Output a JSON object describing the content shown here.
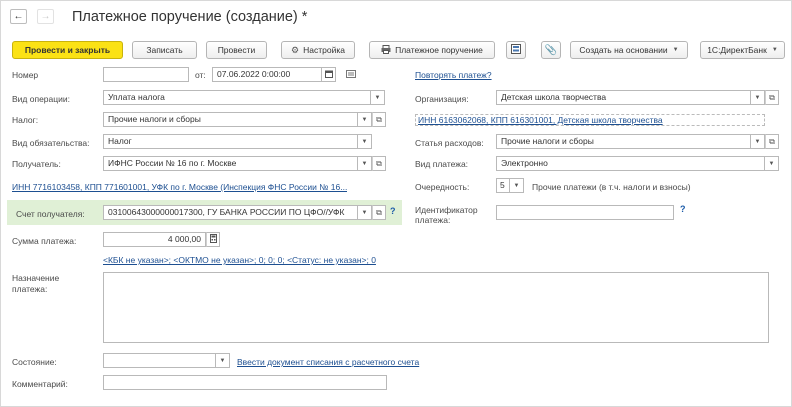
{
  "window": {
    "title": "Платежное поручение (создание) *"
  },
  "nav": {
    "back_glyph": "←",
    "forward_glyph": "→"
  },
  "toolbar": {
    "post_close": "Провести и закрыть",
    "save": "Записать",
    "post": "Провести",
    "settings": "Настройка",
    "payment_order": "Платежное поручение",
    "create_based_on": "Создать на основании",
    "direct_bank": "1С:ДиректБанк"
  },
  "form": {
    "number": {
      "label": "Номер",
      "value": ""
    },
    "date": {
      "label": "от:",
      "value": "07.06.2022  0:00:00"
    },
    "repeat_link": "Повторять платеж?",
    "operation": {
      "label": "Вид операции:",
      "value": "Уплата налога"
    },
    "organization": {
      "label": "Организация:",
      "value": "Детская школа творчества"
    },
    "tax": {
      "label": "Налог:",
      "value": "Прочие налоги и сборы"
    },
    "org_details_link": "ИНН 6163062068, КПП 616301001, Детская школа творчества",
    "obligation": {
      "label": "Вид обязательства:",
      "value": "Налог"
    },
    "expense_item": {
      "label": "Статья расходов:",
      "value": "Прочие налоги и сборы"
    },
    "recipient": {
      "label": "Получатель:",
      "value": "ИФНС России № 16 по г. Москве"
    },
    "payment_type": {
      "label": "Вид платежа:",
      "value": "Электронно"
    },
    "recipient_link": "ИНН 7716103458, КПП 771601001, УФК по г. Москве (Инспекция ФНС России № 16...",
    "priority": {
      "label": "Очередность:",
      "value": "5",
      "note": "Прочие платежи (в т.ч. налоги и взносы)"
    },
    "recipient_account": {
      "label": "Счет получателя:",
      "value": "03100643000000017300, ГУ БАНКА РОССИИ ПО ЦФО//УФК"
    },
    "payment_id": {
      "label_line1": "Идентификатор",
      "label_line2": "платежа:",
      "value": ""
    },
    "amount": {
      "label": "Сумма платежа:",
      "value": "4 000,00"
    },
    "kbk_link": "<КБК не указан>; <ОКТМО не указан>; 0; 0; 0; <Статус: не указан>; 0",
    "purpose": {
      "label_line1": "Назначение",
      "label_line2": "платежа:",
      "value": ""
    },
    "state": {
      "label": "Состояние:",
      "value": ""
    },
    "enter_document_link": "Ввести документ списания с расчетного счета",
    "comment": {
      "label": "Комментарий:",
      "value": ""
    },
    "help_glyph": "?"
  }
}
